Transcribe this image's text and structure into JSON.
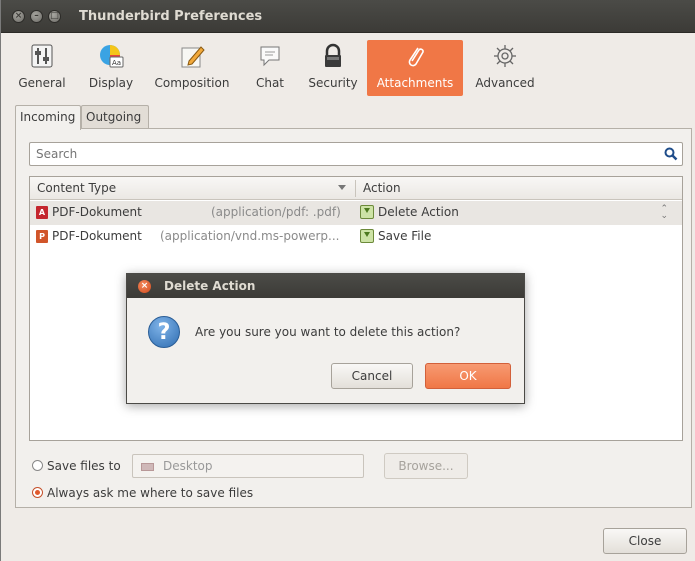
{
  "window": {
    "title": "Thunderbird Preferences"
  },
  "toolbar": {
    "items": [
      {
        "label": "General",
        "icon": "sliders-icon"
      },
      {
        "label": "Display",
        "icon": "palette-icon"
      },
      {
        "label": "Composition",
        "icon": "pencil-icon"
      },
      {
        "label": "Chat",
        "icon": "chat-bubble-icon"
      },
      {
        "label": "Security",
        "icon": "lock-icon"
      },
      {
        "label": "Attachments",
        "icon": "paperclip-icon",
        "active": true
      },
      {
        "label": "Advanced",
        "icon": "gear-icon"
      }
    ]
  },
  "tabs": [
    {
      "label": "Incoming",
      "active": true
    },
    {
      "label": "Outgoing"
    }
  ],
  "search": {
    "placeholder": "Search"
  },
  "table": {
    "columns": [
      "Content Type",
      "Action"
    ],
    "rows": [
      {
        "name": "PDF-Dokument",
        "mime": "(application/pdf: .pdf)",
        "action": "Delete Action",
        "selected": true,
        "icon_color": "#c4262e",
        "icon_letter": "A"
      },
      {
        "name": "PDF-Dokument",
        "mime": "(application/vnd.ms-powerp...",
        "action": "Save File",
        "selected": false,
        "icon_color": "#d1552a",
        "icon_letter": "P"
      }
    ]
  },
  "save_options": {
    "save_files_to": "Save files to",
    "folder": "Desktop",
    "browse": "Browse...",
    "always_ask": "Always ask me where to save files",
    "selected": "always_ask"
  },
  "close_label": "Close",
  "dialog": {
    "title": "Delete Action",
    "message": "Are you sure you want to delete this action?",
    "cancel": "Cancel",
    "ok": "OK"
  },
  "colors": {
    "accent": "#f07746",
    "titlebar": "#3c3b37"
  }
}
